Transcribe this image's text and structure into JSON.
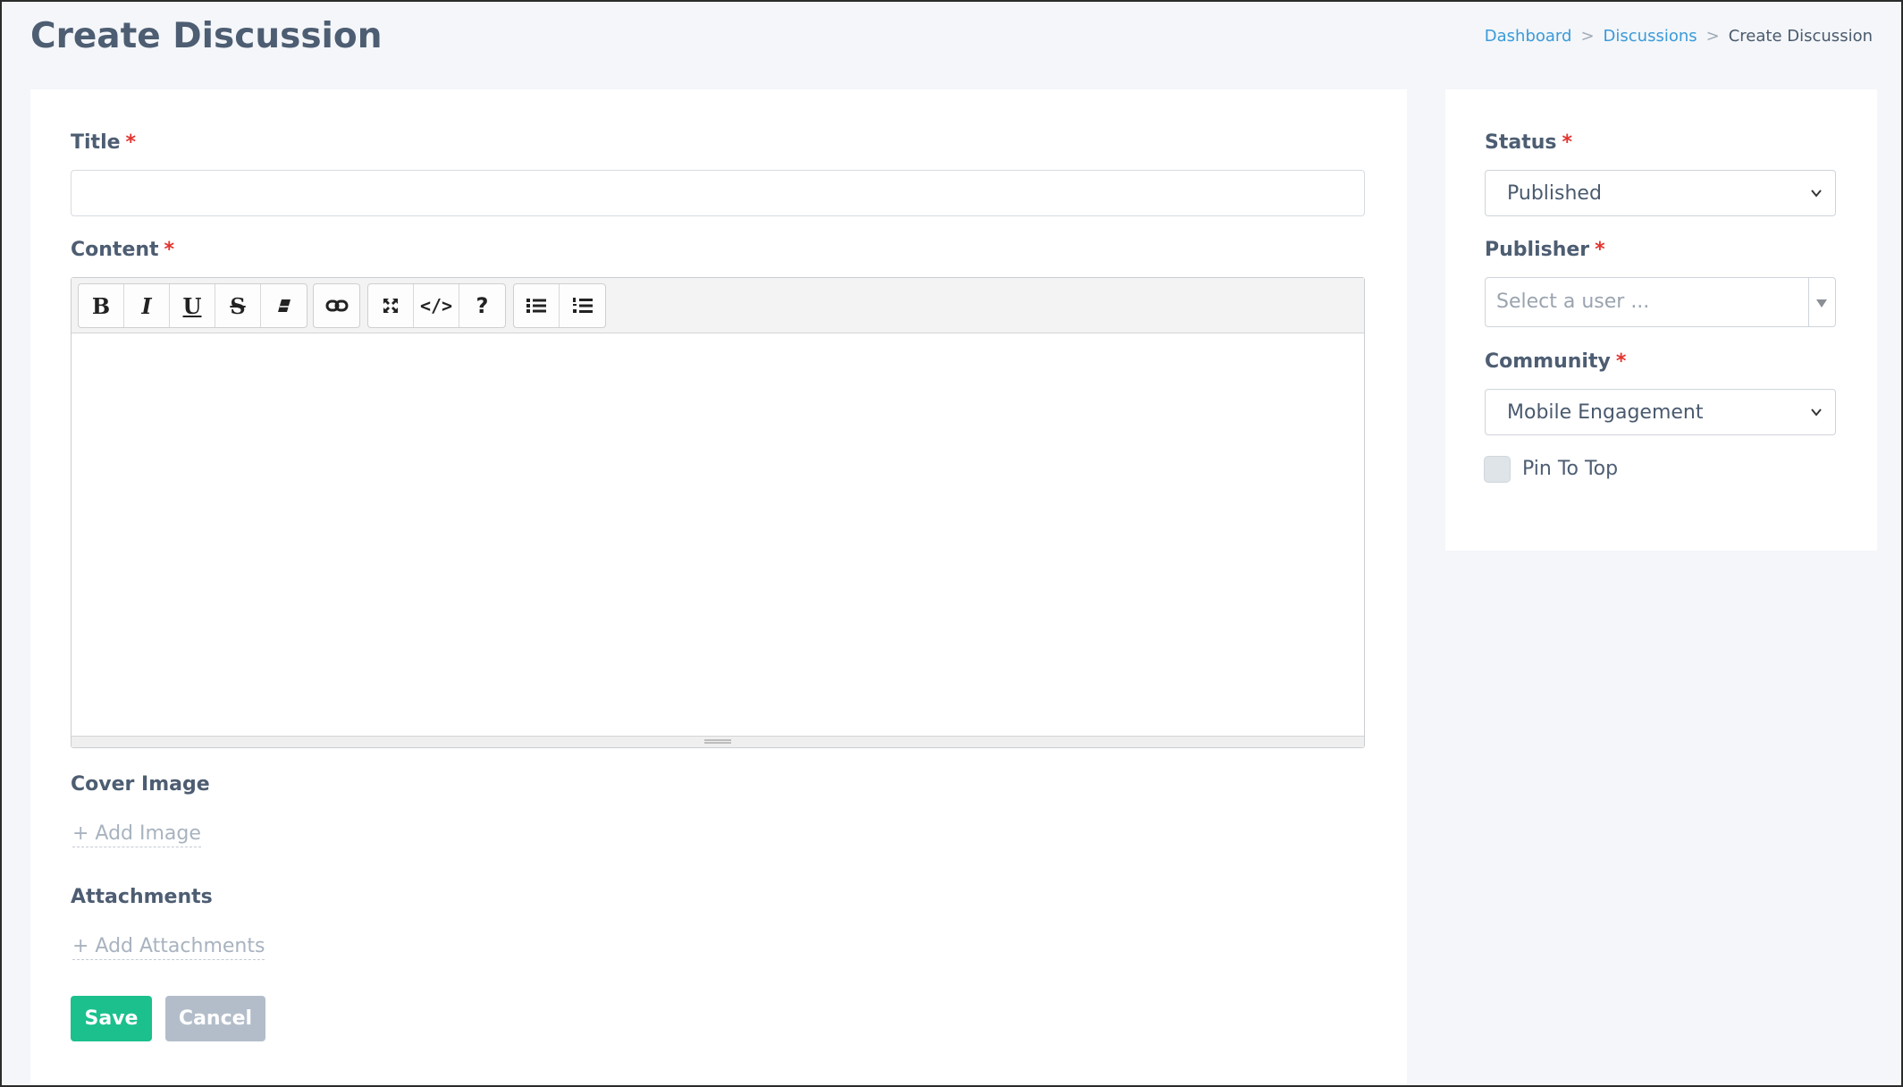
{
  "page": {
    "title": "Create Discussion"
  },
  "breadcrumb": {
    "items": [
      "Dashboard",
      "Discussions",
      "Create Discussion"
    ],
    "separator": ">"
  },
  "form": {
    "title_label": "Title",
    "title_value": "",
    "content_label": "Content",
    "required_mark": "*",
    "toolbar_buttons": [
      "bold-icon",
      "italic-icon",
      "underline-icon",
      "strikethrough-icon",
      "eraser-icon",
      "link-icon",
      "fullscreen-icon",
      "code-icon",
      "help-icon",
      "bullet-list-icon",
      "numbered-list-icon"
    ],
    "toolbar_glyphs": {
      "bold": "B",
      "italic": "I",
      "underline": "U",
      "strike": "S",
      "code": "</>",
      "help": "?"
    },
    "cover_image_label": "Cover Image",
    "add_image_label": "+ Add Image",
    "attachments_label": "Attachments",
    "add_attachments_label": "+ Add Attachments",
    "save_label": "Save",
    "cancel_label": "Cancel"
  },
  "sidebar": {
    "status_label": "Status",
    "status_value": "Published",
    "publisher_label": "Publisher",
    "publisher_placeholder": "Select a user ...",
    "community_label": "Community",
    "community_value": "Mobile Engagement",
    "pin_label": "Pin To Top",
    "pin_checked": false
  },
  "colors": {
    "accent_link": "#3a9ad9",
    "save_button": "#1bc08d",
    "cancel_button": "#b3bdca",
    "required": "#e3342f"
  }
}
